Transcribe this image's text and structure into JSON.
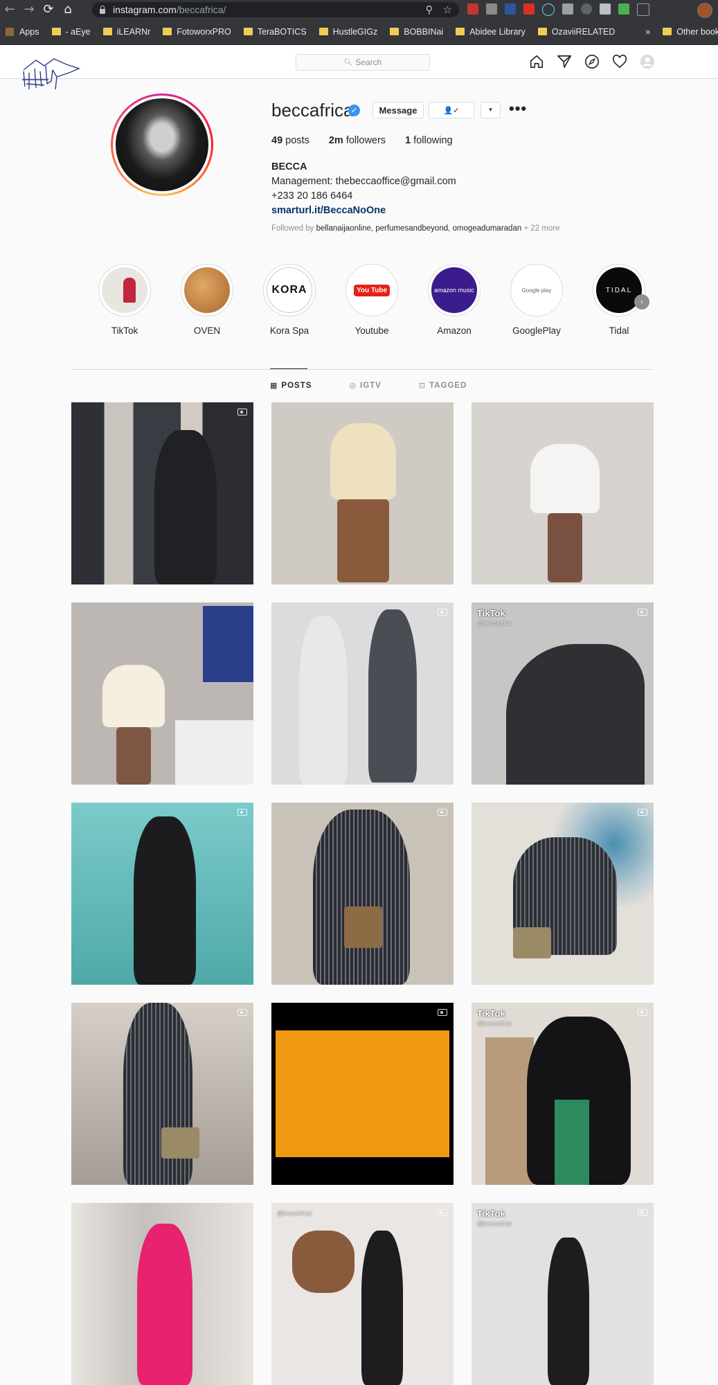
{
  "browser": {
    "url_host": "instagram.com",
    "url_path": "/beccafrica/",
    "bookmarks": [
      "Apps",
      "- aEye",
      "iLEARNr",
      "FotoworxPRO",
      "TeraBOTICS",
      "HustleGIGz",
      "BOBBINai",
      "Abidee Library",
      "OzaviiRELATED"
    ],
    "overflow": "»",
    "other_bookmarks": "Other bookmarks"
  },
  "header": {
    "search_placeholder": "Search"
  },
  "profile": {
    "username": "beccafrica",
    "message_label": "Message",
    "follow_glyph": "👤✓",
    "dropdown_glyph": "▾",
    "more_glyph": "•••",
    "posts_count": "49",
    "posts_label": "posts",
    "followers_count": "2m",
    "followers_label": "followers",
    "following_count": "1",
    "following_label": "following",
    "full_name": "BECCA",
    "bio_line1": "Management: thebeccaoffice@gmail.com",
    "bio_line2": "+233 20 186 6464",
    "link": "smarturl.it/BeccaNoOne",
    "followed_by_prefix": "Followed by",
    "followed_by_names": "bellanaijaonline, perfumesandbeyond, omogeadumaradan",
    "followed_by_more": "+ 22 more"
  },
  "highlights": [
    {
      "label": "TikTok",
      "bg": "#e9e6e2"
    },
    {
      "label": "OVEN",
      "bg": "#c98a4b"
    },
    {
      "label": "Kora Spa",
      "bg": "#ffffff",
      "logo": "KORA"
    },
    {
      "label": "Youtube",
      "bg": "#ffffff",
      "logo": "You Tube"
    },
    {
      "label": "Amazon",
      "bg": "#3b1c8c",
      "logo": "amazon music"
    },
    {
      "label": "GooglePlay",
      "bg": "#ffffff",
      "logo": "Google play"
    },
    {
      "label": "Tidal",
      "bg": "#0a0a0a",
      "logo": "TIDAL"
    }
  ],
  "tabs": [
    {
      "label": "POSTS",
      "icon": "grid-icon",
      "active": true
    },
    {
      "label": "IGTV",
      "icon": "igtv-icon",
      "active": false
    },
    {
      "label": "TAGGED",
      "icon": "tagged-icon",
      "active": false
    }
  ],
  "posts": [
    {
      "bg": "#3d3f46",
      "video": true
    },
    {
      "bg": "#cfcac3",
      "video": false
    },
    {
      "bg": "#d7d3cf",
      "video": false
    },
    {
      "bg": "#bdb7b4",
      "video": false
    },
    {
      "bg": "#dcdcde",
      "video": true
    },
    {
      "bg": "#c8c6c4",
      "video": true,
      "tiktok": "TikTok",
      "handle": "@beccafrica"
    },
    {
      "bg": "#6fbcbb",
      "video": true
    },
    {
      "bg": "#c9c2b8",
      "video": true
    },
    {
      "bg": "#e3dfd9",
      "video": true
    },
    {
      "bg": "#c1b9b2",
      "video": true
    },
    {
      "bg": "#000000",
      "video": true,
      "inner": "#ef9a10"
    },
    {
      "bg": "#e1dbd6",
      "video": true,
      "tiktok": "TikTok",
      "handle": "@beccafrica"
    },
    {
      "bg": "#d7d6d4",
      "video": false
    },
    {
      "bg": "#e9e6e4",
      "video": true,
      "handle": "@beccafrica"
    },
    {
      "bg": "#e2e1df",
      "video": true,
      "tiktok": "TikTok",
      "handle": "@beccafrica"
    }
  ]
}
